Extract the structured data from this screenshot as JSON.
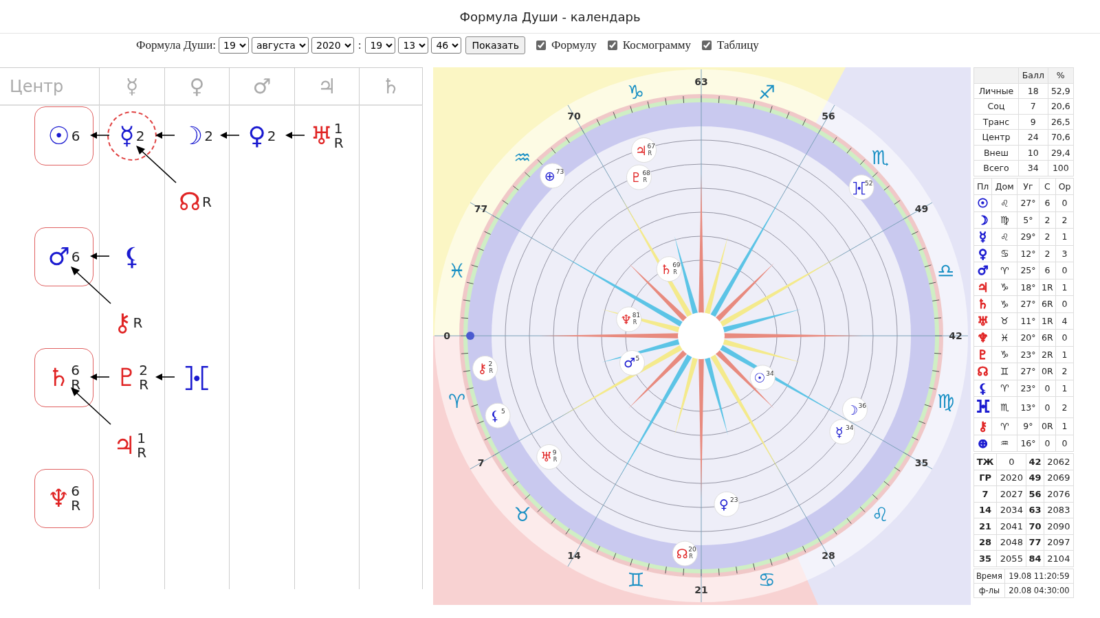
{
  "title": "Формула Души - календарь",
  "controls": {
    "label": "Формула Души:",
    "selects": [
      "19",
      "августа",
      "2020",
      ":",
      "19",
      "13",
      "46"
    ],
    "button": "Показать",
    "checkboxes": [
      {
        "label": "Формулу",
        "checked": true
      },
      {
        "label": "Космограмму",
        "checked": true
      },
      {
        "label": "Таблицу",
        "checked": true
      }
    ]
  },
  "formula": {
    "header": [
      "Центр",
      "☿",
      "♀",
      "♂",
      "♃",
      "♄"
    ],
    "groups": [
      {
        "chain": [
          {
            "glyph": "☉",
            "color": "#1a1ad0",
            "score": "6",
            "circled": false
          },
          {
            "glyph": "☿",
            "color": "#1a1ad0",
            "score": "2",
            "circled": true,
            "branch": {
              "glyph": "☊",
              "color": "#e02424",
              "retro": "R"
            }
          },
          {
            "glyph": "☽",
            "color": "#1a1ad0",
            "score": "2",
            "circled": false
          },
          {
            "glyph": "♀",
            "color": "#1a1ad0",
            "score": "2",
            "circled": false
          },
          {
            "glyph": "♅",
            "color": "#e02424",
            "score": "1",
            "retro": "R",
            "circled": false
          }
        ]
      },
      {
        "chain": [
          {
            "glyph": "♂",
            "color": "#1a1ad0",
            "score": "6",
            "circled": false,
            "branch": {
              "glyph": "⚷",
              "color": "#e02424",
              "retro": "R"
            }
          },
          {
            "glyph": "⚸",
            "color": "#1a1ad0",
            "circled": false
          }
        ]
      },
      {
        "chain": [
          {
            "glyph": "♄",
            "color": "#e02424",
            "score": "6",
            "retro": "R",
            "circled": false,
            "branch": {
              "glyph": "♃",
              "color": "#e02424",
              "score": "1",
              "retro": "R"
            }
          },
          {
            "glyph": "♇",
            "color": "#e02424",
            "score": "2",
            "retro": "R",
            "circled": false
          },
          {
            "glyph": "⯘",
            "color": "#1a1ad0",
            "circled": false
          }
        ]
      },
      {
        "chain": [
          {
            "glyph": "♆",
            "color": "#e02424",
            "score": "6",
            "retro": "R",
            "circled": false
          }
        ]
      }
    ]
  },
  "cosmogram": {
    "ages": [
      "0",
      "7",
      "14",
      "21",
      "28",
      "35",
      "42",
      "49",
      "56",
      "63",
      "70",
      "77"
    ],
    "signs": [
      "♈",
      "♉",
      "♊",
      "♋",
      "♌",
      "♍",
      "♎",
      "♏",
      "♐",
      "♑",
      "♒",
      "♓"
    ],
    "markers": [
      {
        "glyph": "☉",
        "age": "34"
      },
      {
        "glyph": "☽",
        "age": "36"
      },
      {
        "glyph": "☿",
        "age": "34"
      },
      {
        "glyph": "♀",
        "age": "23"
      },
      {
        "glyph": "♂",
        "age": "5"
      },
      {
        "glyph": "♃",
        "age": "67",
        "retro": "R"
      },
      {
        "glyph": "♄",
        "age": "69",
        "retro": "R"
      },
      {
        "glyph": "♅",
        "age": "9",
        "retro": "R"
      },
      {
        "glyph": "♆",
        "age": "81",
        "retro": "R"
      },
      {
        "glyph": "♇",
        "age": "68",
        "retro": "R"
      },
      {
        "glyph": "☊",
        "age": "20",
        "retro": "R"
      },
      {
        "glyph": "⚸",
        "age": "5"
      },
      {
        "glyph": "⯘",
        "age": "52"
      },
      {
        "glyph": "⚷",
        "age": "2",
        "retro": "R"
      },
      {
        "glyph": "⊕",
        "age": "73"
      }
    ]
  },
  "scores": {
    "columns": [
      "",
      "Балл",
      "%"
    ],
    "rows": [
      [
        "Личные",
        "18",
        "52,9"
      ],
      [
        "Соц",
        "7",
        "20,6"
      ],
      [
        "Транс",
        "9",
        "26,5"
      ],
      [
        "Центр",
        "24",
        "70,6"
      ],
      [
        "Внеш",
        "10",
        "29,4"
      ],
      [
        "Всего",
        "34",
        "100"
      ]
    ]
  },
  "planets": {
    "columns": [
      "Пл",
      "Дом",
      "Уг",
      "С",
      "Ор"
    ],
    "rows": [
      {
        "color": "#1a1ad0",
        "cells": [
          "☉",
          "♌",
          "27°",
          "6",
          "0"
        ]
      },
      {
        "color": "#1a1ad0",
        "cells": [
          "☽",
          "♍",
          "5°",
          "2",
          "2"
        ]
      },
      {
        "color": "#1a1ad0",
        "cells": [
          "☿",
          "♌",
          "29°",
          "2",
          "1"
        ]
      },
      {
        "color": "#1a1ad0",
        "cells": [
          "♀",
          "♋",
          "12°",
          "2",
          "3"
        ]
      },
      {
        "color": "#1a1ad0",
        "cells": [
          "♂",
          "♈",
          "25°",
          "6",
          "0"
        ]
      },
      {
        "color": "#e02424",
        "cells": [
          "♃",
          "♑",
          "18°",
          "1R",
          "1"
        ]
      },
      {
        "color": "#e02424",
        "cells": [
          "♄",
          "♑",
          "27°",
          "6R",
          "0"
        ]
      },
      {
        "color": "#e02424",
        "cells": [
          "♅",
          "♉",
          "11°",
          "1R",
          "4"
        ]
      },
      {
        "color": "#e02424",
        "cells": [
          "♆",
          "♓",
          "20°",
          "6R",
          "0"
        ]
      },
      {
        "color": "#e02424",
        "cells": [
          "♇",
          "♑",
          "23°",
          "2R",
          "1"
        ]
      },
      {
        "color": "#e02424",
        "cells": [
          "☊",
          "♊",
          "27°",
          "0R",
          "2"
        ]
      },
      {
        "color": "#1a1ad0",
        "cells": [
          "⚸",
          "♈",
          "23°",
          "0",
          "1"
        ]
      },
      {
        "color": "#1a1ad0",
        "cells": [
          "⯘",
          "♏",
          "13°",
          "0",
          "2"
        ]
      },
      {
        "color": "#e02424",
        "cells": [
          "⚷",
          "♈",
          "9°",
          "0R",
          "1"
        ]
      },
      {
        "color": "#1a1ad0",
        "cells": [
          "⊕",
          "♒",
          "16°",
          "0",
          "0"
        ]
      }
    ]
  },
  "ages": {
    "rows": [
      [
        "ТЖ",
        "0",
        "42",
        "2062"
      ],
      [
        "ГР",
        "2020",
        "49",
        "2069"
      ],
      [
        "7",
        "2027",
        "56",
        "2076"
      ],
      [
        "14",
        "2034",
        "63",
        "2083"
      ],
      [
        "21",
        "2041",
        "70",
        "2090"
      ],
      [
        "28",
        "2048",
        "77",
        "2097"
      ],
      [
        "35",
        "2055",
        "84",
        "2104"
      ]
    ]
  },
  "times": {
    "rows": [
      [
        "Время",
        "19.08 11:20:59"
      ],
      [
        "ф-лы",
        "20.08 04:30:00"
      ]
    ]
  }
}
